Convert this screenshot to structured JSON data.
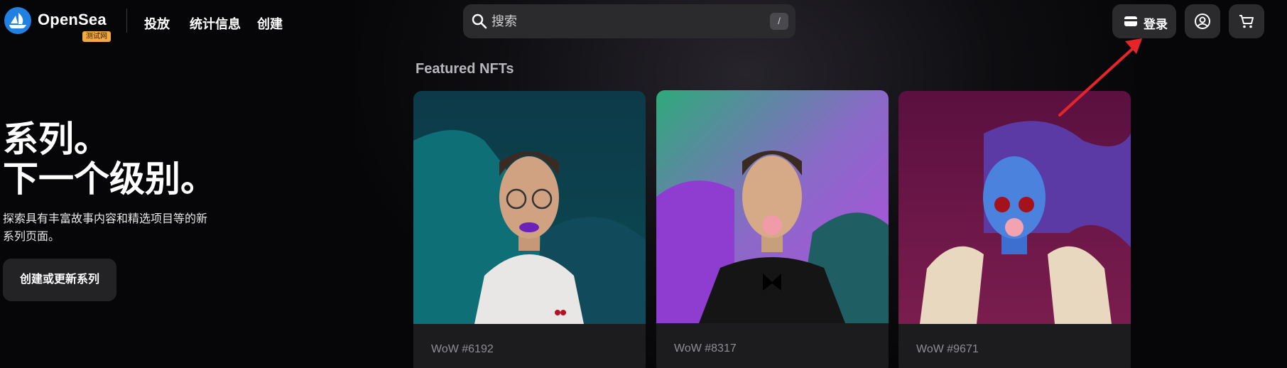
{
  "header": {
    "brand": "OpenSea",
    "badge": "测试网",
    "nav": [
      "投放",
      "统计信息",
      "创建"
    ],
    "search": {
      "placeholder": "搜索",
      "shortcut": "/"
    },
    "login_label": "登录"
  },
  "hero": {
    "title_line1": "系列。",
    "title_line2": "下一个级别。",
    "description": "探索具有丰富故事内容和精选项目等的新系列页面。",
    "cta_label": "创建或更新系列"
  },
  "featured": {
    "heading": "Featured NFTs",
    "cards": [
      {
        "name": "WoW #6192",
        "subtitle": ""
      },
      {
        "name": "WoW #8317",
        "subtitle": ""
      },
      {
        "name": "WoW #9671",
        "subtitle": ""
      }
    ]
  },
  "colors": {
    "accent": "#2081e2",
    "badge": "#f4a941",
    "annotation_arrow": "#e5252a"
  },
  "icons": [
    "opensea-logo-icon",
    "search-icon",
    "wallet-icon",
    "account-icon",
    "cart-icon",
    "annotation-arrow"
  ]
}
